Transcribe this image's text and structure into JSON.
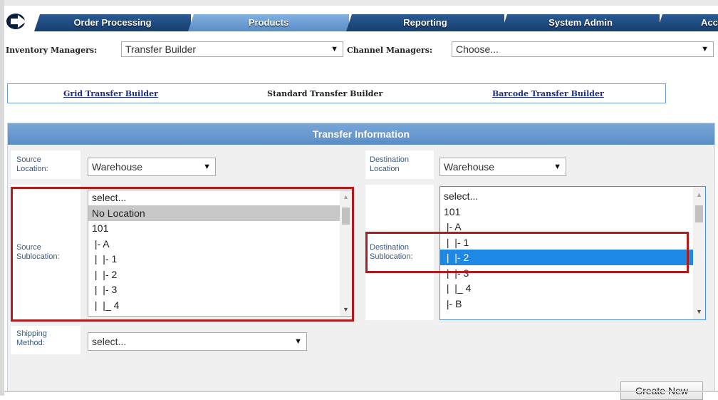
{
  "nav": {
    "tabs": [
      {
        "label": "Order Processing",
        "active": false
      },
      {
        "label": "Products",
        "active": true
      },
      {
        "label": "Reporting",
        "active": false
      },
      {
        "label": "System Admin",
        "active": false
      },
      {
        "label": "Acc",
        "active": false
      }
    ]
  },
  "managers": {
    "inventory_label": "Inventory Managers:",
    "inventory_value": "Transfer Builder",
    "channel_label": "Channel Managers:",
    "channel_value": "Choose..."
  },
  "subnav": {
    "grid": "Grid Transfer Builder",
    "standard": "Standard Transfer Builder",
    "barcode": "Barcode Transfer Builder"
  },
  "panel": {
    "title": "Transfer Information",
    "source_location_label": "Source Location:",
    "source_location_value": "Warehouse",
    "destination_location_label": "Destination Location",
    "destination_location_value": "Warehouse",
    "source_sublocation_label": "Source Sublocation:",
    "destination_sublocation_label": "Destination Sublocation:",
    "source_options": [
      "select...",
      "No Location",
      "101",
      " |- A",
      " |  |- 1",
      " |  |- 2",
      " |  |- 3",
      " |  |_ 4"
    ],
    "source_selected_index": 1,
    "destination_options": [
      "select...",
      "101",
      " |- A",
      " |  |- 1",
      " |  |- 2",
      " |  |- 3",
      " |  |_ 4",
      " |- B"
    ],
    "destination_selected_index": 4,
    "shipping_label": "Shipping Method:",
    "shipping_value": "select...",
    "create_button": "Create New"
  },
  "colors": {
    "tab_dark": "#1c4a80",
    "tab_active": "#6f9fd6",
    "panel_header": "#6a9bd2",
    "highlight_box": "#b01c1c",
    "selected_blue": "#1e88e5"
  }
}
